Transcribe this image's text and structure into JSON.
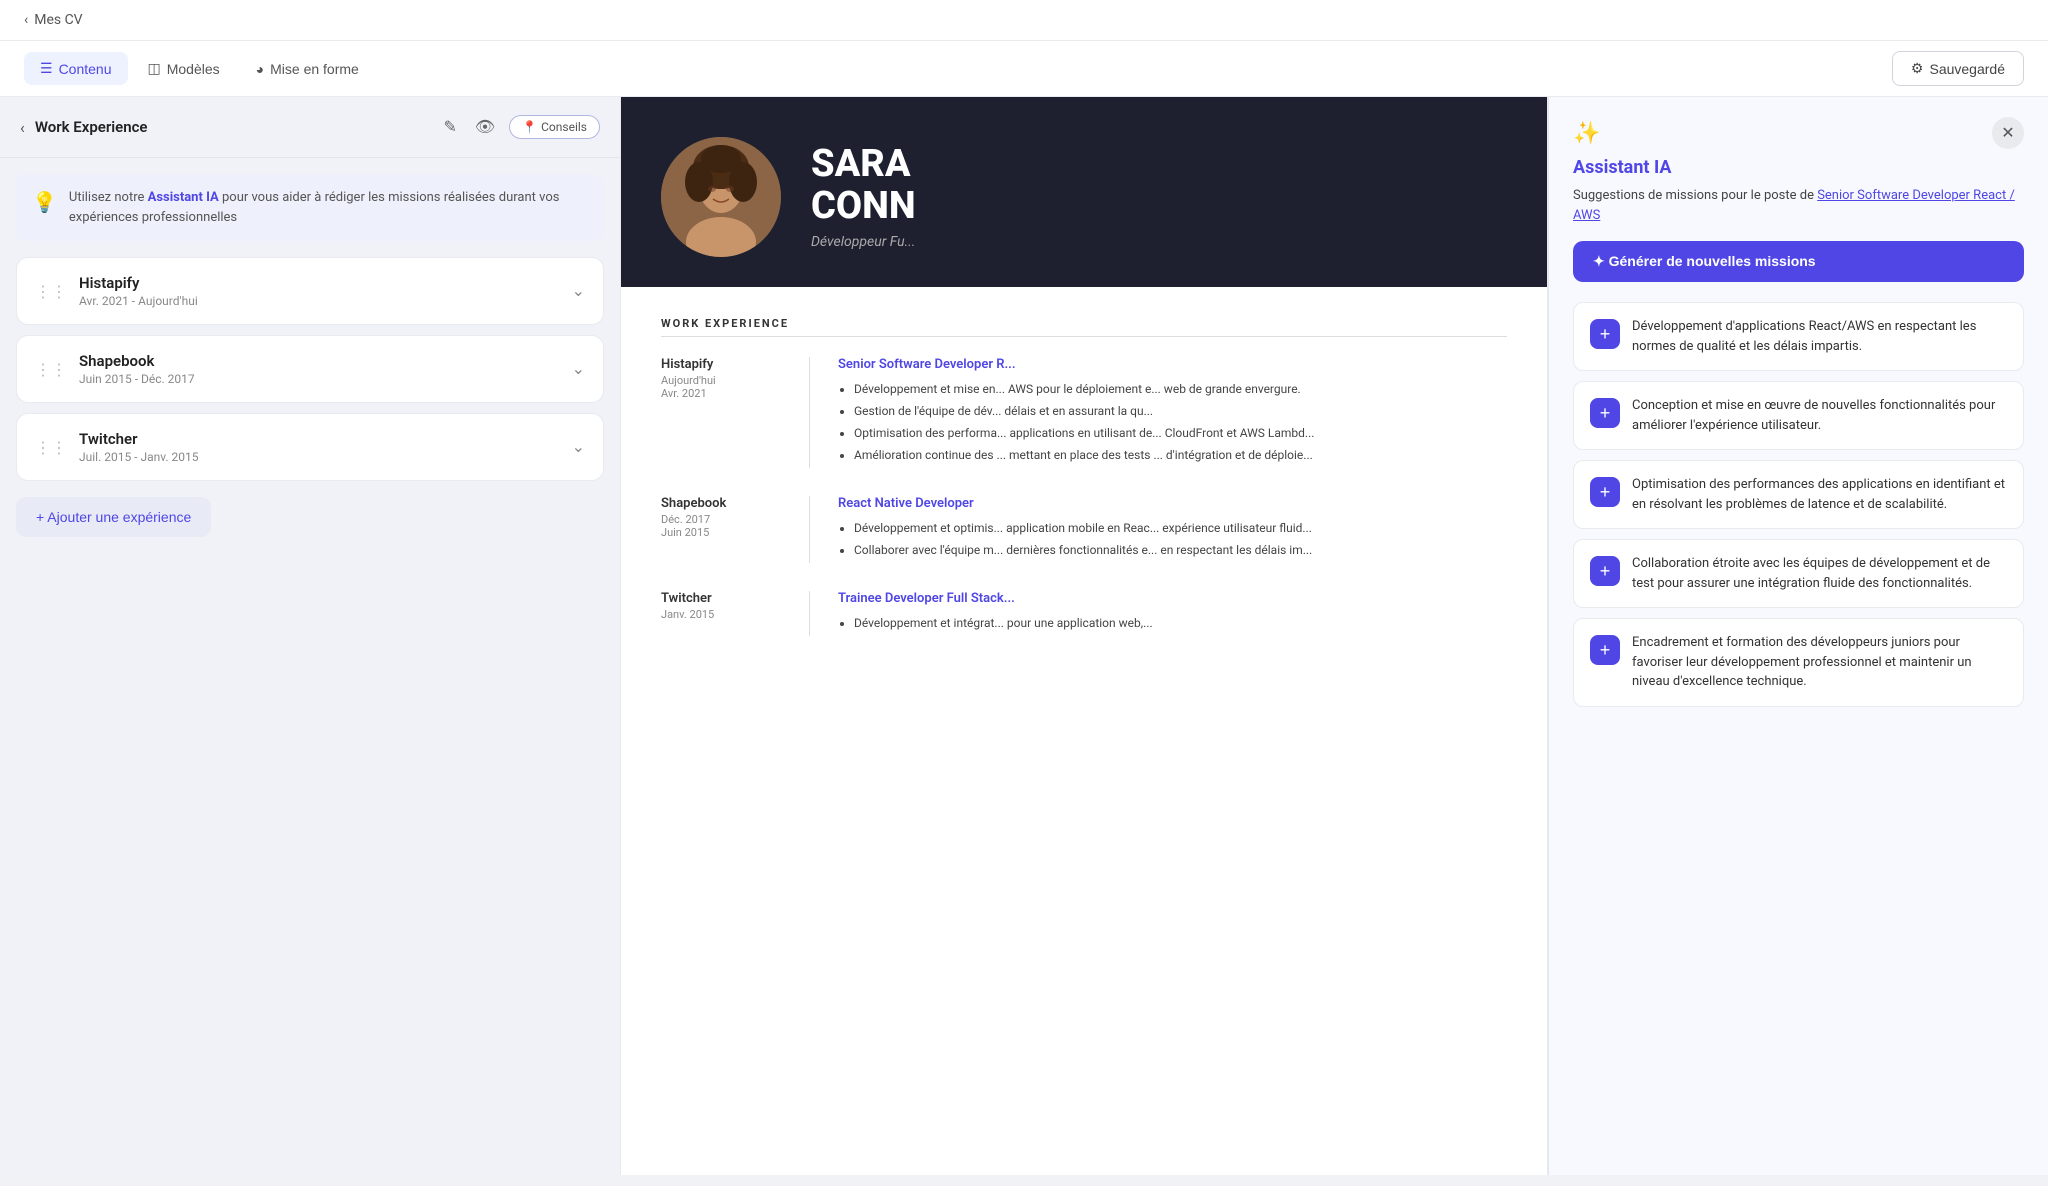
{
  "topnav": {
    "back_label": "Mes CV"
  },
  "tabbar": {
    "tabs": [
      {
        "id": "contenu",
        "label": "Contenu",
        "icon": "≡",
        "active": true
      },
      {
        "id": "modeles",
        "label": "Modèles",
        "icon": "⊞",
        "active": false
      },
      {
        "id": "mise_en_forme",
        "label": "Mise en forme",
        "icon": "◎",
        "active": false
      }
    ],
    "save_btn": "Sauvegardé"
  },
  "section": {
    "title": "Work Experience",
    "conseils_label": "Conseils"
  },
  "ai_hint": {
    "text_before": "Utilisez notre ",
    "highlight": "Assistant IA",
    "text_after": " pour vous aider à rédiger les missions réalisées durant vos expériences professionnelles"
  },
  "experiences": [
    {
      "id": "histapify",
      "name": "Histapify",
      "date": "Avr. 2021 - Aujourd'hui"
    },
    {
      "id": "shapebook",
      "name": "Shapebook",
      "date": "Juin 2015 - Déc. 2017"
    },
    {
      "id": "twitcher",
      "name": "Twitcher",
      "date": "Juil. 2015 - Janv. 2015"
    }
  ],
  "add_exp_label": "+ Ajouter une expérience",
  "cv": {
    "name": "SARA CONN",
    "subtitle": "Développeur Fu...",
    "header_bg": "#1e2030",
    "section_title": "WORK EXPERIENCE",
    "jobs": [
      {
        "company": "Histapify",
        "period_from": "Aujourd'hui",
        "period_to": "Avr. 2021",
        "role": "Senior Software Developer R...",
        "bullets": [
          "Développement et mise en... AWS pour le déploiement e... web de grande envergure.",
          "Gestion de l'équipe de dév... délais et en assurant la qu...",
          "Optimisation des performa... applications en utilisant de... CloudFront et AWS Lambd...",
          "Amélioration continue des ... mettant en place des tests ... d'intégration et de déploie..."
        ]
      },
      {
        "company": "Shapebook",
        "period_from": "Déc. 2017",
        "period_to": "Juin 2015",
        "role": "React Native Developer",
        "bullets": [
          "Développement et optimis... application mobile en Reac... expérience utilisateur fluid...",
          "Collaborer avec l'équipe m... dernières fonctionnalités e... en respectant les délais im..."
        ]
      },
      {
        "company": "Twitcher",
        "period_from": "Janv. 2015",
        "period_to": "",
        "role": "Trainee Developer Full Stack...",
        "bullets": [
          "Développement et intégrat... pour une application web,..."
        ]
      }
    ]
  },
  "ai_panel": {
    "title": "Assistant IA",
    "subtitle_before": "Suggestions de missions pour le poste de ",
    "subtitle_link": "Senior Software Developer React / AWS",
    "generate_btn": "✦ Générer de nouvelles missions",
    "suggestions": [
      "Développement d'applications React/AWS en respectant les normes de qualité et les délais impartis.",
      "Conception et mise en œuvre de nouvelles fonctionnalités pour améliorer l'expérience utilisateur.",
      "Optimisation des performances des applications en identifiant et en résolvant les problèmes de latence et de scalabilité.",
      "Collaboration étroite avec les équipes de développement et de test pour assurer une intégration fluide des fonctionnalités.",
      "Encadrement et formation des développeurs juniors pour favoriser leur développement professionnel et maintenir un niveau d'excellence technique."
    ]
  }
}
